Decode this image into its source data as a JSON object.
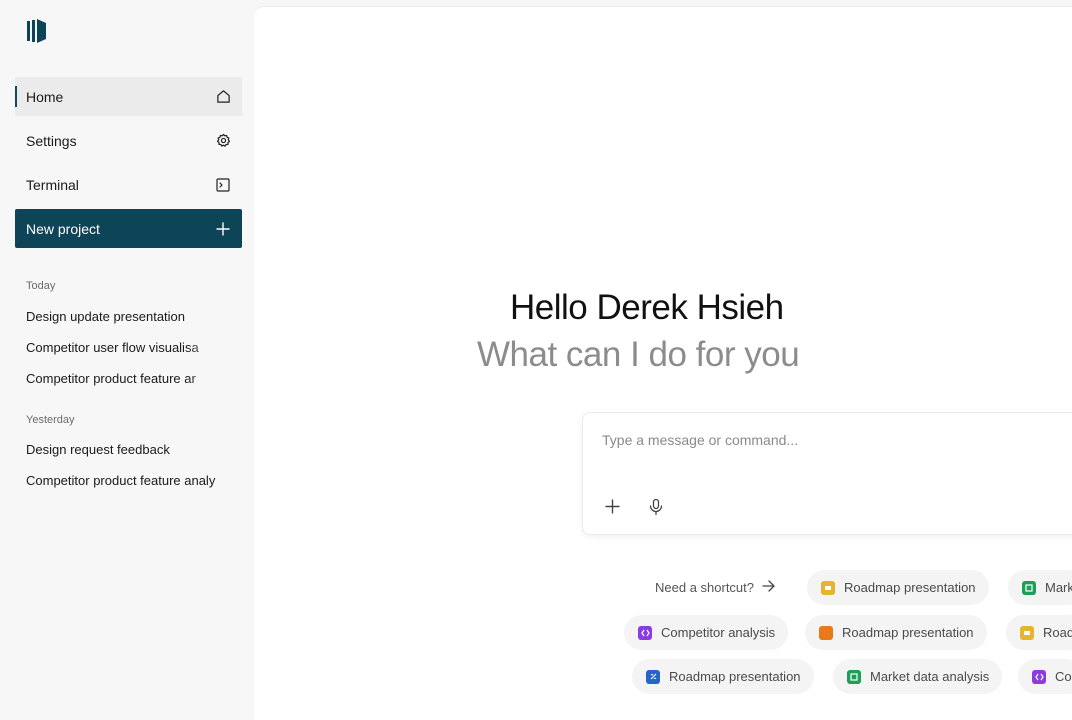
{
  "sidebar": {
    "nav": [
      {
        "label": "Home",
        "icon": "home-icon"
      },
      {
        "label": "Settings",
        "icon": "gear-icon"
      },
      {
        "label": "Terminal",
        "icon": "terminal-icon"
      },
      {
        "label": "New project",
        "icon": "plus-icon"
      }
    ],
    "today_label": "Today",
    "today": [
      "Design update presentation",
      "Competitor user flow visualisa",
      "Competitor product feature ar"
    ],
    "yesterday_label": "Yesterday",
    "yesterday": [
      "Design request feedback",
      "Competitor product feature analy"
    ]
  },
  "main": {
    "greeting": "Hello Derek Hsieh",
    "subgreeting": "What can I do for you",
    "composer": {
      "placeholder": "Type a message or command..."
    },
    "shortcut_label": "Need a shortcut?",
    "chips_row1": [
      {
        "label": "Roadmap presentation",
        "color": "#e5b52f",
        "icon": "slides-file-icon"
      },
      {
        "label": "Mark",
        "color": "#1e9e57",
        "icon": "sheet-file-icon"
      }
    ],
    "chips_row2": [
      {
        "label": "Competitor analysis",
        "color": "#8a3ce0",
        "icon": "code-file-icon"
      },
      {
        "label": "Roadmap presentation",
        "color": "#e87a1a",
        "icon": "doc-file-icon"
      },
      {
        "label": "Road",
        "color": "#e5b52f",
        "icon": "slides-file-icon"
      }
    ],
    "chips_row3": [
      {
        "label": "Roadmap presentation",
        "color": "#2563c9",
        "icon": "link-file-icon"
      },
      {
        "label": "Market data analysis",
        "color": "#1e9e57",
        "icon": "sheet-file-icon"
      },
      {
        "label": "Co",
        "color": "#8a3ce0",
        "icon": "code-file-icon"
      }
    ]
  },
  "colors": {
    "accent": "#0d4458",
    "sidebar_bg": "#f7f7f7"
  }
}
